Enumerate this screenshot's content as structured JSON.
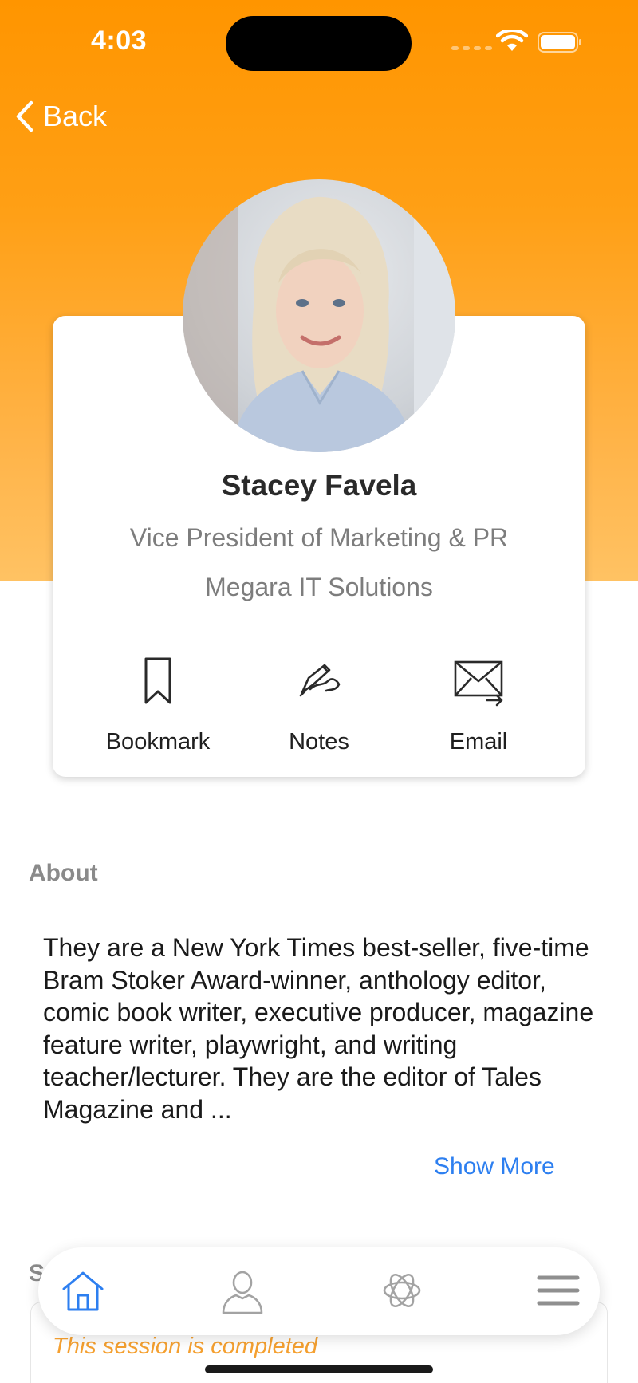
{
  "status_bar": {
    "time": "4:03"
  },
  "nav": {
    "back_label": "Back"
  },
  "profile": {
    "name": "Stacey Favela",
    "title": "Vice President of Marketing & PR",
    "company": "Megara IT Solutions"
  },
  "actions": [
    {
      "label": "Bookmark",
      "icon": "bookmark-icon"
    },
    {
      "label": "Notes",
      "icon": "pen-icon"
    },
    {
      "label": "Email",
      "icon": "envelope-icon"
    }
  ],
  "about": {
    "heading": "About",
    "body": "They are a New York Times best-seller, five-time Bram Stoker Award-winner, anthology editor, comic book writer, executive producer, magazine feature writer, playwright, and writing teacher/lecturer. They are the editor of Tales Magazine and ...",
    "show_more": "Show More"
  },
  "sessions": {
    "heading_peek": "S",
    "status_text": "This session is completed"
  },
  "tabbar": {
    "items": [
      {
        "icon": "home-icon",
        "active": true
      },
      {
        "icon": "person-icon",
        "active": false
      },
      {
        "icon": "ai-icon",
        "active": false
      },
      {
        "icon": "menu-icon",
        "active": false
      }
    ]
  },
  "colors": {
    "accent": "#ff9500",
    "link": "#2d7ff0",
    "session_status": "#f5a030"
  }
}
